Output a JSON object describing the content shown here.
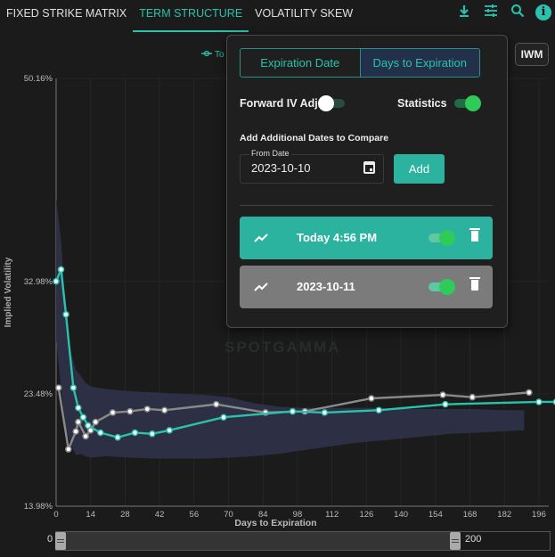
{
  "tabs": [
    "FIXED STRIKE MATRIX",
    "TERM STRUCTURE",
    "VOLATILITY SKEW"
  ],
  "active_tab": "TERM STRUCTURE",
  "toolbar": {
    "icons": [
      "download-icon",
      "sliders-icon",
      "search-icon",
      "info-icon"
    ],
    "info_glyph": "i"
  },
  "symbol": "IWM",
  "legend_fragment": "To",
  "watermark": "SPOTGAMMA",
  "colors": {
    "accent": "#2bc2ad",
    "today": "#2bc2ad",
    "compare": "#8a8a8a",
    "band": "#2e3148",
    "panel_bg": "#1f1f1f"
  },
  "panel": {
    "mode_options": [
      "Expiration Date",
      "Days to Expiration"
    ],
    "mode_selected": "Days to Expiration",
    "forward_iv_label": "Forward IV Adj.",
    "forward_iv_on": false,
    "statistics_label": "Statistics",
    "statistics_on": true,
    "compare_heading": "Add Additional Dates to Compare",
    "from_date_label": "From Date",
    "from_date_value": "2023-10-10",
    "add_label": "Add",
    "entries": [
      {
        "label": "Today 4:56 PM",
        "color": "#2bb3a0",
        "visible": true
      },
      {
        "label": "2023-10-11",
        "color": "#7b7b7b",
        "visible": true
      }
    ]
  },
  "slider": {
    "min_value": "0",
    "max_value": "200",
    "low": 0,
    "high": 200
  },
  "chart_data": {
    "type": "line",
    "ylabel": "Implied Volatility",
    "xlabel": "Days to Expiration",
    "xlim": [
      0,
      200
    ],
    "ylim": [
      13.98,
      50.16
    ],
    "y_ticks": [
      "50.16%",
      "32.98%",
      "23.48%",
      "13.98%"
    ],
    "y_tick_values": [
      50.16,
      32.98,
      23.48,
      13.98
    ],
    "x_ticks": [
      "0",
      "14",
      "28",
      "42",
      "56",
      "70",
      "84",
      "98",
      "112",
      "126",
      "140",
      "154",
      "168",
      "182",
      "196"
    ],
    "grid": true,
    "statistics_band": {
      "x": [
        0,
        2,
        4,
        6,
        8,
        10,
        12,
        14,
        20,
        30,
        40,
        50,
        60,
        70,
        80,
        90,
        100,
        110,
        120,
        130,
        140,
        150,
        160,
        170,
        180,
        190
      ],
      "upper": [
        40.0,
        36.5,
        30.0,
        27.0,
        25.5,
        25.0,
        24.4,
        24.1,
        23.9,
        23.7,
        23.6,
        23.5,
        23.4,
        23.2,
        22.7,
        22.4,
        22.3,
        22.3,
        22.3,
        22.3,
        22.2,
        22.2,
        22.2,
        22.2,
        22.1,
        22.1
      ],
      "lower": [
        28.0,
        24.0,
        20.5,
        19.2,
        18.3,
        18.4,
        18.2,
        18.1,
        18.2,
        18.1,
        18.0,
        18.0,
        18.0,
        18.1,
        18.2,
        18.4,
        18.7,
        19.0,
        19.3,
        19.5,
        19.7,
        19.9,
        20.1,
        20.2,
        20.3,
        20.4
      ]
    },
    "series": [
      {
        "name": "Today 4:56 PM",
        "x": [
          0,
          2,
          4,
          7,
          9,
          11,
          13,
          18,
          25,
          32,
          39,
          46,
          68,
          96,
          109,
          131,
          158,
          196,
          203
        ],
        "y": [
          33.0,
          34.0,
          30.2,
          24.0,
          22.3,
          21.5,
          20.8,
          20.2,
          19.8,
          20.2,
          20.1,
          20.4,
          21.5,
          22.0,
          21.9,
          22.1,
          22.6,
          22.8,
          22.8
        ]
      },
      {
        "name": "2023-10-11",
        "x": [
          1,
          5,
          8,
          9,
          12,
          14,
          16,
          23,
          30,
          37,
          44,
          65,
          85,
          101,
          128,
          157,
          169,
          192
        ],
        "y": [
          24.0,
          18.8,
          20.3,
          21.1,
          19.9,
          20.4,
          21.1,
          21.9,
          22.0,
          22.2,
          22.1,
          22.6,
          21.9,
          22.0,
          23.1,
          23.4,
          23.2,
          23.6
        ]
      }
    ]
  }
}
